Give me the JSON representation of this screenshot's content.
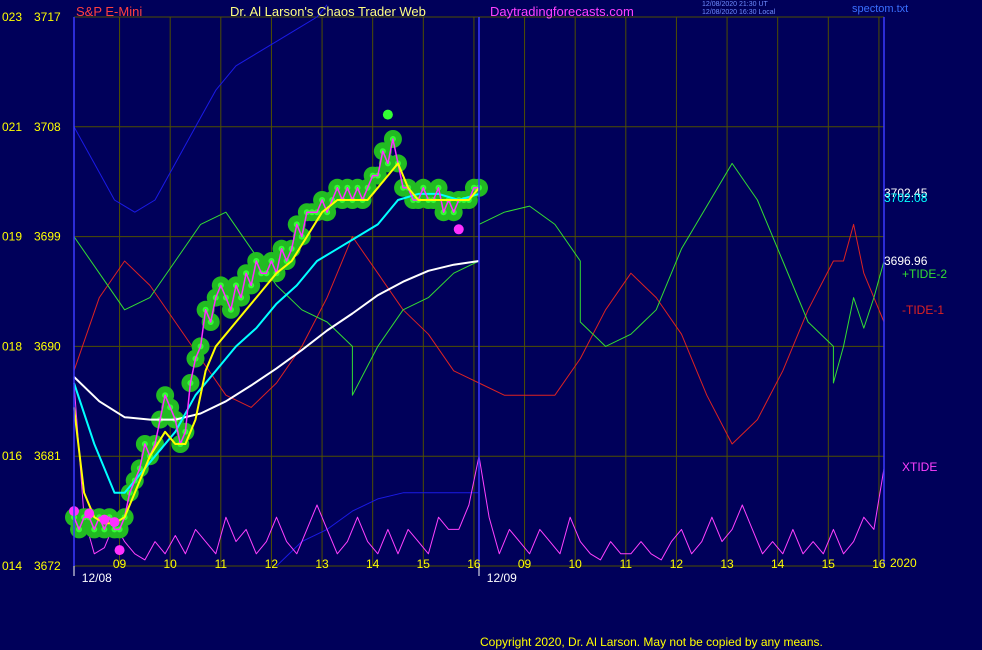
{
  "header": {
    "symbol": "S&P E-Mini",
    "title": "Dr. Al Larson's Chaos Trader Web",
    "site": "Daytradingforecasts.com",
    "timestamp_utc": "12/08/2020 21:30 UT",
    "timestamp_local": "12/08/2020 16:30 Local",
    "filename": "spectom.txt"
  },
  "colors": {
    "background": "#00005a",
    "grid": "#4f4f00",
    "axis_frame": "#3a3aff",
    "symbol": "#ff4040",
    "title": "#ffff80",
    "site": "#ff40ff",
    "price": "#ff30ff",
    "price_glow": "#22bb22",
    "price_points": "#33ff33",
    "fast_avg": "#ffff00",
    "mid_avg": "#00ffff",
    "slow_avg": "#ffffff",
    "tide_plus2": "#33dd33",
    "tide_minus1": "#dd2222",
    "xtide": "#ff40ff",
    "upper_blue": "#1a1ae6",
    "tick_labels": "#ffff00",
    "dates": "#ffffff"
  },
  "copyright": "Copyright 2020, Dr. Al Larson. May not be copied by any means.",
  "right_labels": {
    "v1": "3702.45",
    "v2": "3702.08",
    "v3": "3696.96",
    "tide_plus2": "+TIDE-2",
    "tide_minus1": "-TIDE-1",
    "xtide": "XTIDE",
    "year": "2020"
  },
  "chart_data": {
    "type": "line",
    "ylim": [
      3672,
      3717
    ],
    "xlim": [
      0,
      16
    ],
    "now_x": 8.0,
    "y_ticks": [
      {
        "left": "023",
        "value": 3717,
        "label": "3717"
      },
      {
        "left": "021",
        "value": 3708,
        "label": "3708"
      },
      {
        "left": "019",
        "value": 3699,
        "label": "3699"
      },
      {
        "left": "018",
        "value": 3690,
        "label": "3690"
      },
      {
        "left": "016",
        "value": 3681,
        "label": "3681"
      },
      {
        "left": "014",
        "value": 3672,
        "label": "3672"
      }
    ],
    "x_ticks": [
      {
        "x": 0.9,
        "label": "09"
      },
      {
        "x": 1.9,
        "label": "10"
      },
      {
        "x": 2.9,
        "label": "11"
      },
      {
        "x": 3.9,
        "label": "12"
      },
      {
        "x": 4.9,
        "label": "13"
      },
      {
        "x": 5.9,
        "label": "14"
      },
      {
        "x": 6.9,
        "label": "15"
      },
      {
        "x": 7.9,
        "label": "16"
      },
      {
        "x": 8.9,
        "label": "09"
      },
      {
        "x": 9.9,
        "label": "10"
      },
      {
        "x": 10.9,
        "label": "11"
      },
      {
        "x": 11.9,
        "label": "12"
      },
      {
        "x": 12.9,
        "label": "13"
      },
      {
        "x": 13.9,
        "label": "14"
      },
      {
        "x": 14.9,
        "label": "15"
      },
      {
        "x": 15.9,
        "label": "16"
      }
    ],
    "date_labels": [
      {
        "x": 0.45,
        "label": "12/08"
      },
      {
        "x": 8.45,
        "label": "12/09"
      }
    ],
    "price": {
      "name": "S&P E-Mini",
      "x": [
        0.0,
        0.1,
        0.2,
        0.3,
        0.4,
        0.5,
        0.6,
        0.7,
        0.8,
        0.9,
        1.0,
        1.1,
        1.2,
        1.3,
        1.4,
        1.5,
        1.6,
        1.7,
        1.8,
        1.9,
        2.0,
        2.1,
        2.2,
        2.3,
        2.4,
        2.5,
        2.6,
        2.7,
        2.8,
        2.9,
        3.0,
        3.1,
        3.2,
        3.3,
        3.4,
        3.5,
        3.6,
        3.7,
        3.8,
        3.9,
        4.0,
        4.1,
        4.2,
        4.3,
        4.4,
        4.5,
        4.6,
        4.7,
        4.8,
        4.9,
        5.0,
        5.1,
        5.2,
        5.3,
        5.4,
        5.5,
        5.6,
        5.7,
        5.8,
        5.9,
        6.0,
        6.1,
        6.2,
        6.3,
        6.4,
        6.5,
        6.6,
        6.7,
        6.8,
        6.9,
        7.0,
        7.1,
        7.2,
        7.3,
        7.4,
        7.5,
        7.6,
        7.7,
        7.8,
        7.9,
        8.0
      ],
      "y": [
        3676,
        3675,
        3676,
        3676,
        3675,
        3676,
        3675,
        3676,
        3675,
        3675,
        3676,
        3678,
        3679,
        3680,
        3682,
        3681,
        3682,
        3684,
        3686,
        3685,
        3684,
        3682,
        3683,
        3687,
        3689,
        3690,
        3693,
        3692,
        3694,
        3695,
        3694,
        3693,
        3695,
        3694,
        3696,
        3695,
        3697,
        3696,
        3696,
        3697,
        3696,
        3698,
        3697,
        3698,
        3700,
        3699,
        3701,
        3701,
        3701,
        3702,
        3701,
        3702,
        3703,
        3702,
        3703,
        3702,
        3703,
        3702,
        3703,
        3704,
        3704,
        3706,
        3705,
        3707,
        3705,
        3703,
        3703,
        3702,
        3702,
        3703,
        3702,
        3702,
        3703,
        3701,
        3702,
        3701,
        3702,
        3702,
        3702,
        3703,
        3703
      ],
      "highs": [
        [
          6.2,
          3709
        ]
      ],
      "lows": [
        [
          0.0,
          3676.5
        ],
        [
          0.3,
          3676.3
        ],
        [
          0.6,
          3675.8
        ],
        [
          0.8,
          3675.6
        ],
        [
          0.9,
          3673.3
        ],
        [
          7.6,
          3699.6
        ]
      ]
    },
    "fast_avg": {
      "x": [
        0.0,
        0.2,
        0.4,
        0.6,
        0.8,
        1.0,
        1.2,
        1.5,
        1.8,
        2.0,
        2.2,
        2.4,
        2.6,
        2.8,
        3.0,
        3.2,
        3.4,
        3.6,
        3.8,
        4.0,
        4.3,
        4.6,
        4.9,
        5.2,
        5.5,
        5.8,
        6.0,
        6.2,
        6.4,
        6.6,
        6.8,
        7.0,
        7.2,
        7.4,
        7.6,
        7.8,
        8.0
      ],
      "y": [
        3685,
        3678,
        3676,
        3675.5,
        3675.5,
        3676,
        3678,
        3681,
        3683,
        3682,
        3682,
        3684,
        3688,
        3690,
        3691,
        3692,
        3693,
        3694,
        3695,
        3696,
        3697,
        3699,
        3701,
        3702,
        3702,
        3702,
        3703,
        3704,
        3705,
        3703,
        3702,
        3702,
        3702,
        3702,
        3702,
        3702,
        3703
      ]
    },
    "mid_avg": {
      "x": [
        0.0,
        0.4,
        0.8,
        1.0,
        1.2,
        1.6,
        2.0,
        2.4,
        2.8,
        3.2,
        3.6,
        4.0,
        4.4,
        4.8,
        5.2,
        5.6,
        6.0,
        6.4,
        6.8,
        7.2,
        7.6,
        8.0
      ],
      "y": [
        3687,
        3682,
        3678,
        3678,
        3679,
        3681,
        3683,
        3686,
        3688,
        3690,
        3691.5,
        3693.5,
        3695,
        3697,
        3698,
        3699,
        3700,
        3702,
        3702.5,
        3702.5,
        3702,
        3702.5
      ]
    },
    "slow_avg": {
      "x": [
        0.0,
        0.5,
        1.0,
        1.5,
        2.0,
        2.5,
        3.0,
        3.5,
        4.0,
        4.5,
        5.0,
        5.5,
        6.0,
        6.5,
        7.0,
        7.5,
        8.0
      ],
      "y": [
        3687.5,
        3685.5,
        3684.2,
        3684,
        3684,
        3684.5,
        3685.5,
        3686.8,
        3688.2,
        3689.7,
        3691.3,
        3692.7,
        3694.2,
        3695.3,
        3696.2,
        3696.7,
        3697
      ]
    },
    "tide_plus2": {
      "name": "+TIDE-2",
      "x": [
        0.0,
        0.5,
        1.0,
        1.5,
        2.0,
        2.5,
        3.0,
        3.5,
        4.0,
        4.5,
        5.0,
        5.5,
        5.5,
        6.0,
        6.5,
        7.0,
        7.5,
        8.0,
        8.0,
        8.5,
        9.0,
        9.5,
        10.0,
        10.0,
        10.5,
        11.0,
        11.5,
        12.0,
        12.5,
        13.0,
        13.5,
        14.0,
        14.5,
        15.0,
        15.0,
        15.2,
        15.4,
        15.6,
        15.8,
        16.0
      ],
      "y": [
        3699,
        3696,
        3693,
        3694,
        3697,
        3700,
        3701,
        3698,
        3695,
        3693,
        3692,
        3690,
        3686,
        3690,
        3693,
        3694,
        3696,
        3697,
        3700,
        3701,
        3701.5,
        3700,
        3697,
        3692,
        3690,
        3691,
        3693,
        3698,
        3701.5,
        3705,
        3702,
        3697,
        3692,
        3690,
        3687,
        3690,
        3694,
        3691.5,
        3694,
        3697
      ]
    },
    "tide_minus1": {
      "name": "-TIDE-1",
      "x": [
        0.0,
        0.5,
        1.0,
        1.5,
        2.0,
        2.5,
        3.0,
        3.5,
        4.0,
        4.5,
        5.0,
        5.5,
        6.0,
        6.5,
        7.0,
        7.5,
        8.0,
        8.5,
        9.0,
        9.5,
        10.0,
        10.5,
        11.0,
        11.5,
        12.0,
        12.5,
        13.0,
        13.5,
        14.0,
        14.5,
        15.0,
        15.2,
        15.4,
        15.6,
        15.8,
        16.0
      ],
      "y": [
        3688,
        3694,
        3697,
        3695,
        3692,
        3689,
        3686,
        3685,
        3687,
        3690,
        3694,
        3699,
        3696,
        3693,
        3691,
        3688,
        3687,
        3686,
        3686,
        3686,
        3689,
        3693,
        3696,
        3694,
        3691,
        3686,
        3682,
        3684,
        3688,
        3693,
        3697,
        3697,
        3700,
        3696,
        3694,
        3692
      ]
    },
    "xtide": {
      "name": "XTIDE",
      "x": [
        0.0,
        0.2,
        0.4,
        0.6,
        0.8,
        1.0,
        1.2,
        1.4,
        1.6,
        1.8,
        2.0,
        2.2,
        2.4,
        2.6,
        2.8,
        3.0,
        3.2,
        3.4,
        3.6,
        3.8,
        4.0,
        4.2,
        4.4,
        4.6,
        4.8,
        5.0,
        5.2,
        5.4,
        5.6,
        5.8,
        6.0,
        6.2,
        6.4,
        6.6,
        6.8,
        7.0,
        7.2,
        7.4,
        7.6,
        7.8,
        8.0,
        8.2,
        8.4,
        8.6,
        8.8,
        9.0,
        9.2,
        9.4,
        9.6,
        9.8,
        10.0,
        10.2,
        10.4,
        10.6,
        10.8,
        11.0,
        11.2,
        11.4,
        11.6,
        11.8,
        12.0,
        12.2,
        12.4,
        12.6,
        12.8,
        13.0,
        13.2,
        13.4,
        13.6,
        13.8,
        14.0,
        14.2,
        14.4,
        14.6,
        14.8,
        15.0,
        15.2,
        15.4,
        15.6,
        15.8,
        16.0
      ],
      "y": [
        3687,
        3676,
        3673,
        3673.5,
        3675.5,
        3674,
        3673,
        3672.5,
        3674,
        3673,
        3674.5,
        3673,
        3675,
        3674,
        3673,
        3676,
        3674,
        3675,
        3673,
        3674,
        3676,
        3674,
        3673,
        3675,
        3677,
        3675,
        3673,
        3674,
        3676,
        3674,
        3673,
        3675,
        3673,
        3675,
        3674,
        3673,
        3676,
        3675,
        3675,
        3677,
        3681,
        3676,
        3673,
        3675,
        3674,
        3673,
        3675,
        3674,
        3673,
        3676,
        3674,
        3673,
        3672.5,
        3674,
        3673,
        3673,
        3674,
        3673,
        3672.5,
        3674,
        3675,
        3673,
        3674,
        3676,
        3674,
        3675,
        3677,
        3675,
        3673,
        3674,
        3673,
        3675,
        3673,
        3674,
        3673,
        3675,
        3673,
        3674,
        3676,
        3675,
        3680
      ]
    },
    "upper_blue": {
      "x": [
        0.0,
        0.4,
        0.8,
        1.2,
        1.6,
        2.0,
        2.4,
        2.8,
        3.2,
        3.6,
        4.0,
        4.4,
        4.8,
        5.0
      ],
      "y": [
        3708,
        3705,
        3702,
        3701,
        3702,
        3705,
        3708,
        3711,
        3713,
        3714,
        3715,
        3716,
        3717,
        3718
      ]
    },
    "lower_blue": {
      "x": [
        4.0,
        4.5,
        5.0,
        5.5,
        6.0,
        6.5,
        7.0,
        7.5,
        8.0
      ],
      "y": [
        3672,
        3674,
        3675,
        3676.5,
        3677.5,
        3678,
        3678,
        3678,
        3678
      ]
    }
  }
}
